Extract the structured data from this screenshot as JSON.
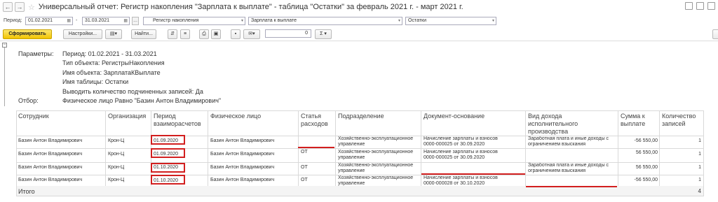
{
  "window": {
    "title": "Универсальный отчет: Регистр накопления \"Зарплата к выплате\" - таблица \"Остатки\" за февраль 2021 г. - март 2021 г.",
    "back_icon": "←",
    "forward_icon": "→",
    "star_icon": "☆"
  },
  "period_bar": {
    "period_label": "Период:",
    "from": "01.02.2021",
    "dash": "-",
    "to": "31.03.2021",
    "dots": "...",
    "object_type": "Регистр накопления",
    "object_name": "Зарплата к выплате",
    "table_name": "Остатки"
  },
  "toolbar": {
    "generate_label": "Сформировать",
    "settings_label": "Настройки...",
    "find_label": "Найти...",
    "number_value": "0",
    "sigma_label": "Σ"
  },
  "params": {
    "params_label": "Параметры:",
    "period_text": "Период: 01.02.2021 - 31.03.2021",
    "object_type_text": "Тип объекта: РегистрыНакопления",
    "object_name_text": "Имя объекта: ЗарплатаКВыплате",
    "table_name_text": "Имя таблицы: Остатки",
    "show_count_text": "Выводить количество подчиненных записей: Да",
    "filter_label": "Отбор:",
    "filter_text": "Физическое лицо Равно \"Базин Антон Владимирович\""
  },
  "table": {
    "headers": {
      "employee": "Сотрудник",
      "organization": "Организация",
      "period_l1": "Период",
      "period_l2": "взаиморасчетов",
      "person": "Физическое лицо",
      "article_l1": "Статья",
      "article_l2": "расходов",
      "department": "Подразделение",
      "document": "Документ-основание",
      "income_l1": "Вид дохода",
      "income_l2": "исполнительного",
      "income_l3": "производства",
      "amount_l1": "Сумма к",
      "amount_l2": "выплате",
      "count_l1": "Количество",
      "count_l2": "записей"
    },
    "rows": [
      {
        "employee": "Базин Антон Владимирович",
        "organization": "Крон-Ц",
        "period": "01.09.2020",
        "person": "Базин Антон Владимирович",
        "article": "",
        "dept_l1": "Хозяйственно-эксплуатационное",
        "dept_l2": "управление",
        "doc_l1": "Начисление зарплаты и взносов",
        "doc_l2": "0000-000025 от 30.09.2020",
        "income_l1": "Заработная плата и иные доходы с",
        "income_l2": "ограничением взыскания",
        "amount": "-56 550,00",
        "count": "1"
      },
      {
        "employee": "Базин Антон Владимирович",
        "organization": "Крон-Ц",
        "period": "01.09.2020",
        "person": "Базин Антон Владимирович",
        "article": "ОТ",
        "dept_l1": "Хозяйственно-эксплуатационное",
        "dept_l2": "управление",
        "doc_l1": "Начисление зарплаты и взносов",
        "doc_l2": "0000-000025 от 30.09.2020",
        "income_l1": "",
        "income_l2": "",
        "amount": "56 550,00",
        "count": "1"
      },
      {
        "employee": "Базин Антон Владимирович",
        "organization": "Крон-Ц",
        "period": "01.10.2020",
        "person": "Базин Антон Владимирович",
        "article": "ОТ",
        "dept_l1": "Хозяйственно-эксплуатационное",
        "dept_l2": "управление",
        "doc_l1": "",
        "doc_l2": "",
        "income_l1": "Заработная плата и иные доходы с",
        "income_l2": "ограничением взыскания",
        "amount": "56 550,00",
        "count": "1"
      },
      {
        "employee": "Базин Антон Владимирович",
        "organization": "Крон-Ц",
        "period": "01.10.2020",
        "person": "Базин Антон Владимирович",
        "article": "ОТ",
        "dept_l1": "Хозяйственно-эксплуатационное",
        "dept_l2": "управление",
        "doc_l1": "Начисление зарплаты и взносов",
        "doc_l2": "0000-000028 от 30.10.2020",
        "income_l1": "",
        "income_l2": "",
        "amount": "-56 550,00",
        "count": "1"
      }
    ],
    "total_label": "Итого",
    "total_count": "4"
  },
  "colors": {
    "accent_button": "#f2c400",
    "highlight": "#d21f1f"
  }
}
